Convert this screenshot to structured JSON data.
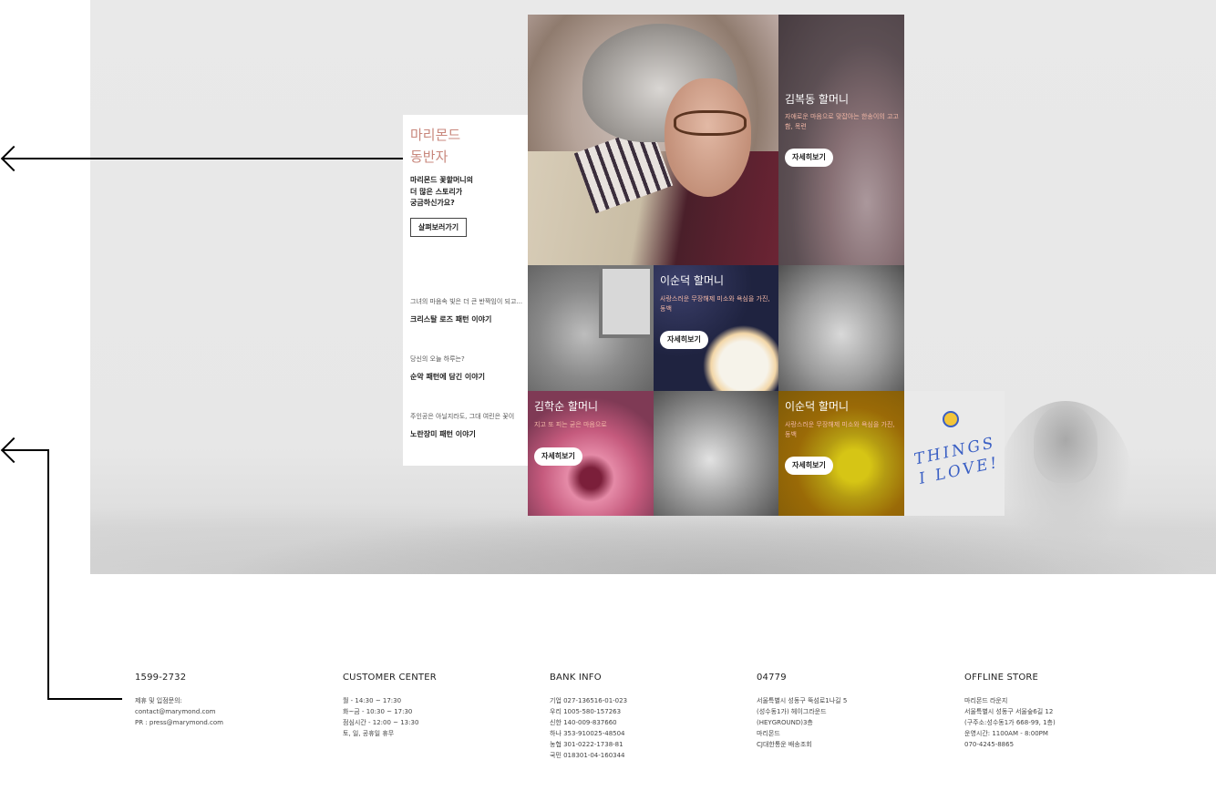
{
  "panel": {
    "title_line1": "마리몬드",
    "title_line2": "동반자",
    "desc_line1": "마리몬드 꽃할머니의",
    "desc_line2": "더 많은 스토리가",
    "desc_line3": "궁금하신가요?",
    "button": "살펴보러가기",
    "stories": [
      {
        "sub": "그녀의 마음속 빛은 더 큰 반짝임이 되고...",
        "title": "크리스탈 로즈 패턴 이야기"
      },
      {
        "sub": "당신의 오늘 하루는?",
        "title": "순악 패턴에 담긴 이야기"
      },
      {
        "sub": "주인공은 아닐지라도, 그대 여린은 꽃이",
        "title": "노란장미 패턴 이야기"
      }
    ]
  },
  "tiles": {
    "kim_bokdong": {
      "title": "김복동 할머니",
      "sub": "자애로운 마음으로 맞잡아는 한송이의 고고함, 목련",
      "button": "자세히보기"
    },
    "lee_sundeok_1": {
      "title": "이순덕 할머니",
      "sub": "사랑스러운 무장해제 미소와 욕심을 가진, 동백",
      "button": "자세히보기"
    },
    "kim_haksun": {
      "title": "김학순 할머니",
      "sub": "지고 또 피는 굳은 마음으로",
      "button": "자세히보기"
    },
    "lee_sundeok_2": {
      "title": "이순덕 할머니",
      "sub": "사랑스러운 무장해제 미소와 욕심을 가진, 동백",
      "button": "자세히보기"
    },
    "things_text": "THINGS I LOVE!"
  },
  "footer": {
    "phone": {
      "heading": "1599-2732",
      "lines": [
        "제휴 및 입점문의:",
        "contact@marymond.com",
        "PR : press@marymond.com"
      ]
    },
    "customer": {
      "heading": "CUSTOMER CENTER",
      "lines": [
        "월 - 14:30 ~ 17:30",
        "화~금 - 10:30 ~ 17:30",
        "점심시간 - 12:00 ~ 13:30",
        "토, 일, 공휴일 휴무"
      ]
    },
    "bank": {
      "heading": "BANK INFO",
      "lines": [
        "기업 027-136516-01-023",
        "우리 1005-580-157263",
        "신한 140-009-837660",
        "하나 353-910025-48504",
        "농협 301-0222-1738-81",
        "국민 018301-04-160344"
      ]
    },
    "address": {
      "heading": "04779",
      "lines": [
        "서울특별시 성동구 뚝섬로1나길 5",
        "(성수동1가) 헤이그라운드",
        "(HEYGROUND)3층",
        "마리몬드",
        "CJ대한통운 배송조회"
      ]
    },
    "store": {
      "heading": "OFFLINE STORE",
      "lines": [
        "마리몬드 라운지",
        "서울특별시 성동구 서울숲6길 12",
        "(구주소:성수동1가 668-99, 1층)",
        "운영시간: 1100AM - 8:00PM",
        "070-4245-8865"
      ]
    }
  },
  "colors": {
    "accent": "#c8877c",
    "tile_subtitle": "#f2b7a6",
    "band": "#e8e8e8"
  }
}
